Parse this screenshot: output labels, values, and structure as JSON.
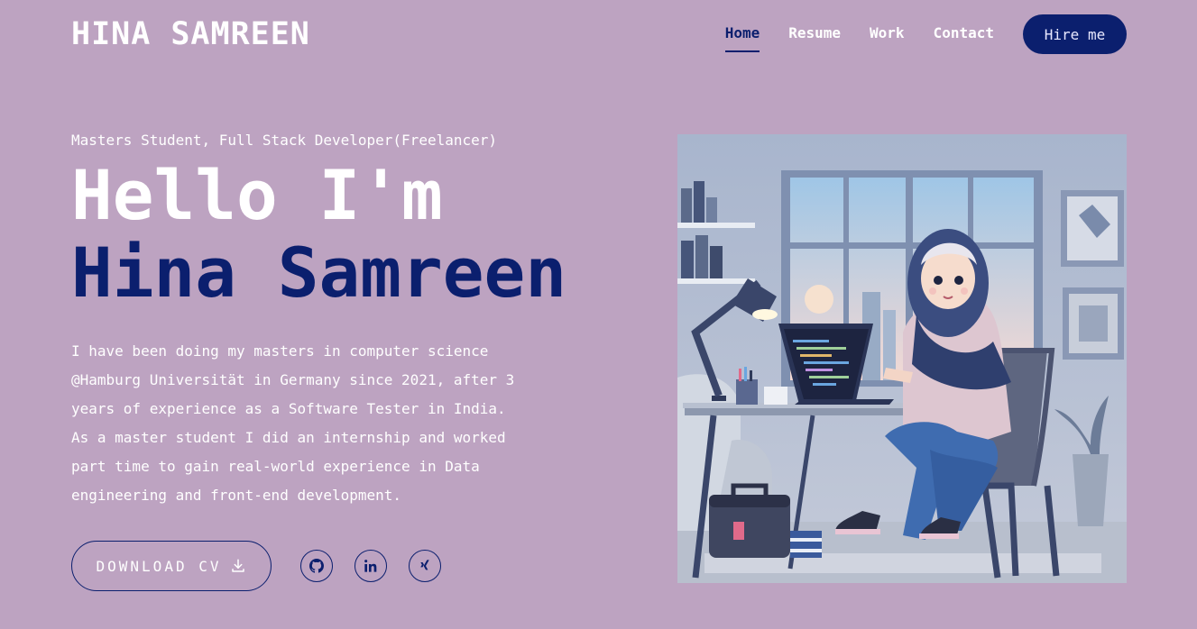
{
  "header": {
    "logo": "HINA SAMREEN",
    "nav": [
      "Home",
      "Resume",
      "Work",
      "Contact"
    ],
    "hire_label": "Hire me"
  },
  "hero": {
    "subtitle": "Masters Student, Full Stack Developer(Freelancer)",
    "greeting": "Hello I'm",
    "name": "Hina Samreen",
    "bio": "I have been doing my masters in computer science @Hamburg Universität in Germany since 2021, after 3 years of experience as a Software Tester in India. As a master student I did an internship and worked part time to gain real-world experience in Data engineering and front-end development.",
    "download_label": "DOWNLOAD CV",
    "socials": [
      {
        "name": "github-icon"
      },
      {
        "name": "linkedin-icon"
      },
      {
        "name": "xing-icon"
      }
    ]
  },
  "colors": {
    "background": "#bda3c1",
    "accent": "#0b1f6e",
    "text": "#ffffff"
  }
}
